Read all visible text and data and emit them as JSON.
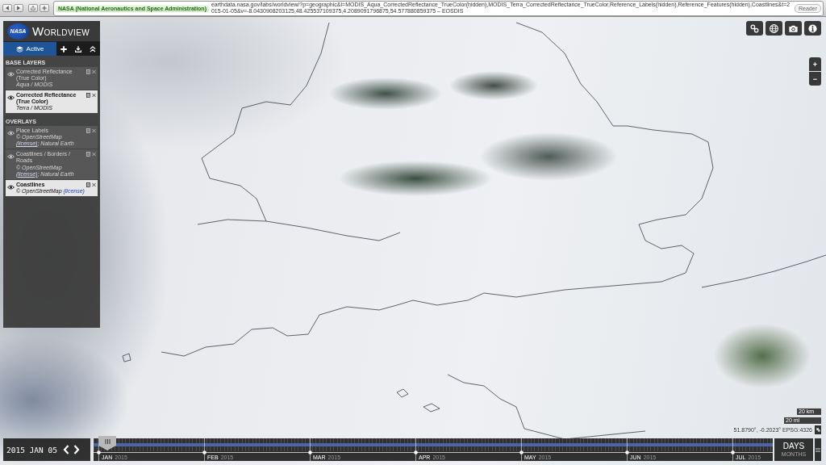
{
  "browser": {
    "security_badge": "NASA (National Aeronautics and Space Administration)",
    "url": "earthdata.nasa.gov/labs/worldview/?p=geographic&l=MODIS_Aqua_CorrectedReflectance_TrueColor(hidden),MODIS_Terra_CorrectedReflectance_TrueColor,Reference_Labels(hidden),Reference_Features(hidden),Coastlines&t=2015-01-05&v=-8.0430908203125,48.425537109375,4.2089091796875,54.577880859375 – EOSDIS",
    "reader_button": "Reader"
  },
  "sidebar": {
    "logo_text": "NASA",
    "title": "WORLDVIEW",
    "tabs": [
      {
        "label": "Active",
        "selected": true
      }
    ],
    "sections": [
      {
        "heading": "BASE LAYERS",
        "layers": [
          {
            "name": "Corrected Reflectance (True Color)",
            "source": [
              {
                "text": "Aqua / MODIS"
              }
            ],
            "visible": false
          },
          {
            "name": "Corrected Reflectance (True Color)",
            "source": [
              {
                "text": "Terra / MODIS"
              }
            ],
            "visible": true
          }
        ]
      },
      {
        "heading": "OVERLAYS",
        "layers": [
          {
            "name": "Place Labels",
            "source": [
              {
                "text": "© OpenStreetMap "
              },
              {
                "text": "(license)",
                "link": true
              },
              {
                "text": "; Natural Earth"
              }
            ],
            "visible": false
          },
          {
            "name": "Coastlines / Borders / Roads",
            "source": [
              {
                "text": "© OpenStreetMap "
              },
              {
                "text": "(license)",
                "link": true
              },
              {
                "text": "; Natural Earth"
              }
            ],
            "visible": false
          },
          {
            "name": "Coastlines",
            "source": [
              {
                "text": "© OpenStreetMap "
              },
              {
                "text": "(license)",
                "link": true
              }
            ],
            "visible": true
          }
        ]
      }
    ]
  },
  "zoom": {
    "in": "+",
    "out": "−"
  },
  "scale": {
    "metric": "20 km",
    "imperial": "20 mi"
  },
  "coordinates": "51.8790°, -0.2023° EPSG:4326",
  "timeline": {
    "date": "2015 JAN 05",
    "months": [
      {
        "label": "JAN",
        "year": "2015"
      },
      {
        "label": "FEB",
        "year": "2015"
      },
      {
        "label": "MAR",
        "year": "2015"
      },
      {
        "label": "APR",
        "year": "2015"
      },
      {
        "label": "MAY",
        "year": "2015"
      },
      {
        "label": "JUN",
        "year": "2015"
      },
      {
        "label": "JUL",
        "year": "2015"
      }
    ],
    "zoom_levels": [
      {
        "label": "DAYS",
        "selected": true
      },
      {
        "label": "MONTHS",
        "selected": false
      }
    ]
  }
}
